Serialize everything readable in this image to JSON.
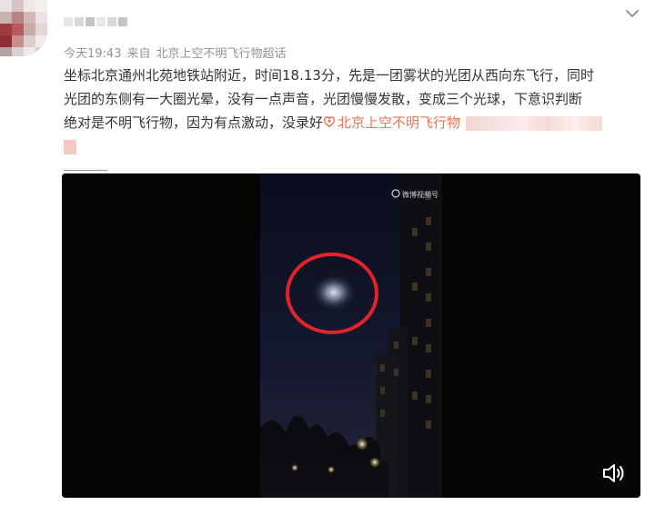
{
  "post": {
    "time": "今天19:43",
    "source_prefix": "来自",
    "source": "北京上空不明飞行物超话",
    "text_line1": "坐标北京通州北苑地铁站附近，时间18.13分，先是一团雾状的光团从西向东飞行，同时",
    "text_line2": "光团的东侧有一大圈光晕，没有一点声音，光团慢慢发散，变成三个光球，下意识判断",
    "text_line3": "绝对是不明飞行物，因为有点激动，没录好",
    "topic_link": "北京上空不明飞行物"
  },
  "video": {
    "watermark": "微博视频号"
  },
  "icons": {
    "menu": "chevron-down-icon",
    "topic": "super-topic-icon",
    "sound": "speaker-icon"
  },
  "colors": {
    "link": "#eb7350",
    "text": "#333333",
    "meta": "#939393",
    "highlight_circle": "#e3232c"
  }
}
